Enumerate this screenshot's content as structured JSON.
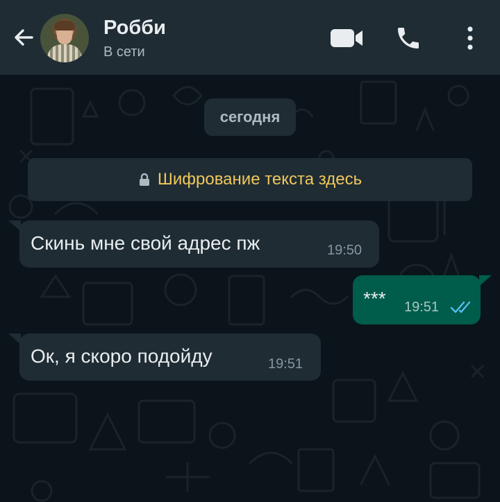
{
  "header": {
    "contact_name": "Робби",
    "status": "В сети",
    "icons": {
      "back": "arrow-left-icon",
      "video": "video-camera-icon",
      "call": "phone-icon",
      "menu": "more-vertical-icon"
    }
  },
  "chat": {
    "date_label": "сегодня",
    "encryption_notice": "Шифрование текста здесь",
    "messages": [
      {
        "direction": "incoming",
        "text": "Скинь мне свой адрес пж",
        "time": "19:50"
      },
      {
        "direction": "outgoing",
        "text": "***",
        "time": "19:51",
        "status": "read"
      },
      {
        "direction": "incoming",
        "text": "Ок, я скоро подойду",
        "time": "19:51"
      }
    ]
  },
  "colors": {
    "header_bg": "#1f2c34",
    "chat_bg": "#0b141a",
    "incoming_bubble": "#1f2c34",
    "outgoing_bubble": "#005c4b",
    "read_ticks": "#53bdeb",
    "encryption_text": "#f0c75a"
  }
}
